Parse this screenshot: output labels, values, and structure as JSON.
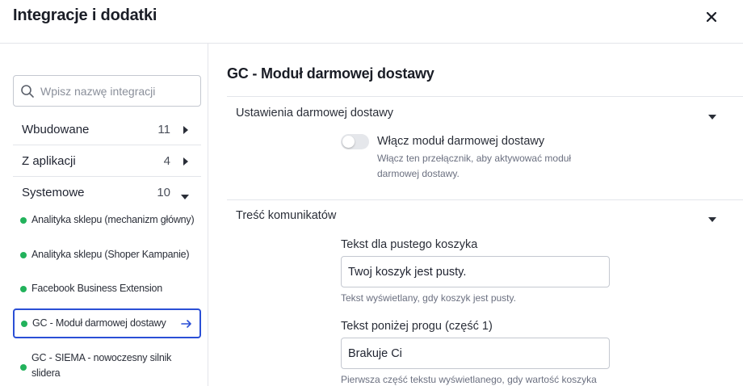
{
  "header": {
    "title": "Integracje i dodatki",
    "close_icon": "close-icon"
  },
  "sidebar": {
    "search": {
      "placeholder": "Wpisz nazwę integracji",
      "value": ""
    },
    "categories": [
      {
        "label": "Wbudowane",
        "count": "11",
        "expanded": false
      },
      {
        "label": "Z aplikacji",
        "count": "4",
        "expanded": false
      },
      {
        "label": "Systemowe",
        "count": "10",
        "expanded": true
      }
    ],
    "integrations": [
      {
        "label": "Analityka sklepu (mechanizm główny)",
        "active": false
      },
      {
        "label": "Analityka sklepu (Shoper Kampanie)",
        "active": false
      },
      {
        "label": "Facebook Business Extension",
        "active": false
      },
      {
        "label": "GC - Moduł darmowej dostawy",
        "active": true
      },
      {
        "label_line1": "GC - SIEMA - nowoczesny silnik",
        "label_line2": "slidera",
        "active": false
      }
    ],
    "status_color": "#22b25b",
    "active_border_color": "#2a4fd6"
  },
  "main": {
    "title": "GC - Moduł darmowej dostawy",
    "sections": [
      {
        "label": "Ustawienia darmowej dostawy",
        "toggle": {
          "title": "Włącz moduł darmowej dostawy",
          "description": "Włącz ten przełącznik, aby aktywować moduł darmowej dostawy.",
          "on": false
        }
      },
      {
        "label": "Treść komunikatów",
        "fields": [
          {
            "label": "Tekst dla pustego koszyka",
            "value": "Twoj koszyk jest pusty.",
            "help": "Tekst wyświetlany, gdy koszyk jest pusty."
          },
          {
            "label": "Tekst poniżej progu (część 1)",
            "value": "Brakuje Ci",
            "help": "Pierwsza część tekstu wyświetlanego, gdy wartość koszyka"
          }
        ]
      }
    ]
  }
}
